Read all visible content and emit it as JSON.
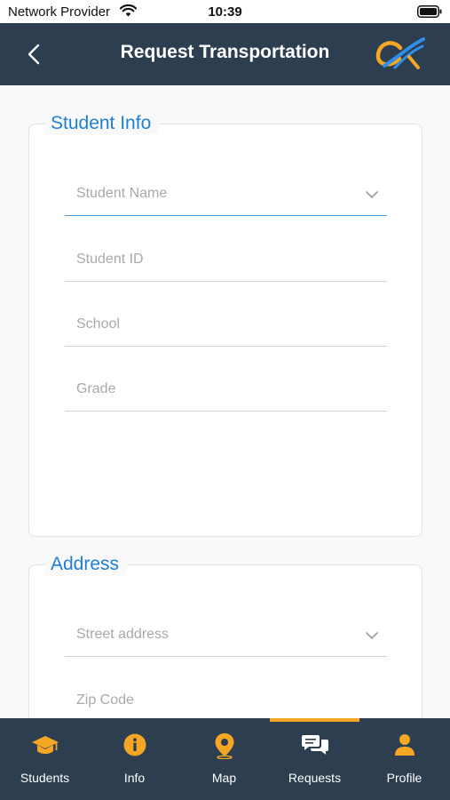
{
  "status_bar": {
    "carrier": "Network Provider",
    "time": "10:39"
  },
  "app_bar": {
    "title": "Request Transportation",
    "back_icon": "chevron-left-icon",
    "logo": "app-logo"
  },
  "student_info": {
    "legend": "Student Info",
    "fields": [
      {
        "placeholder": "Student Name",
        "type": "dropdown"
      },
      {
        "placeholder": "Student ID"
      },
      {
        "placeholder": "School"
      },
      {
        "placeholder": "Grade"
      }
    ]
  },
  "address": {
    "legend": "Address",
    "fields": [
      {
        "placeholder": "Street address",
        "type": "dropdown"
      },
      {
        "placeholder": "Zip Code"
      }
    ]
  },
  "tab_bar": {
    "active_tab": "Requests",
    "tabs": [
      {
        "label": "Students",
        "icon": "graduation-cap-icon"
      },
      {
        "label": "Info",
        "icon": "info-icon"
      },
      {
        "label": "Map",
        "icon": "map-pin-icon"
      },
      {
        "label": "Requests",
        "icon": "chat-bubbles-icon"
      },
      {
        "label": "Profile",
        "icon": "person-icon"
      }
    ]
  },
  "colors": {
    "header": "#2c3e50",
    "accent": "#f5a623",
    "legend": "#1e7fd6",
    "active_underline": "#4a9be2"
  }
}
